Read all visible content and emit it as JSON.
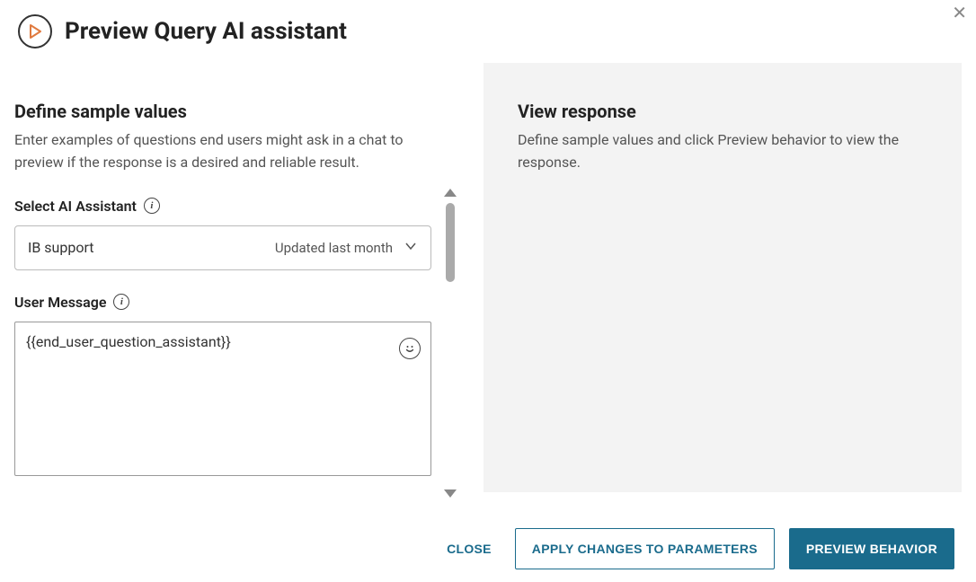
{
  "header": {
    "title": "Preview Query AI assistant"
  },
  "left": {
    "title": "Define sample values",
    "desc": "Enter examples of questions end users might ask in a chat to preview if the response is a desired and reliable result.",
    "select_label": "Select AI Assistant",
    "select_value": "IB support",
    "select_meta": "Updated last month",
    "user_msg_label": "User Message",
    "user_msg_value": "{{end_user_question_assistant}}"
  },
  "right": {
    "title": "View response",
    "desc": "Define sample values and click Preview behavior to view the response."
  },
  "footer": {
    "close": "CLOSE",
    "apply": "APPLY CHANGES TO PARAMETERS",
    "preview": "PREVIEW BEHAVIOR"
  }
}
